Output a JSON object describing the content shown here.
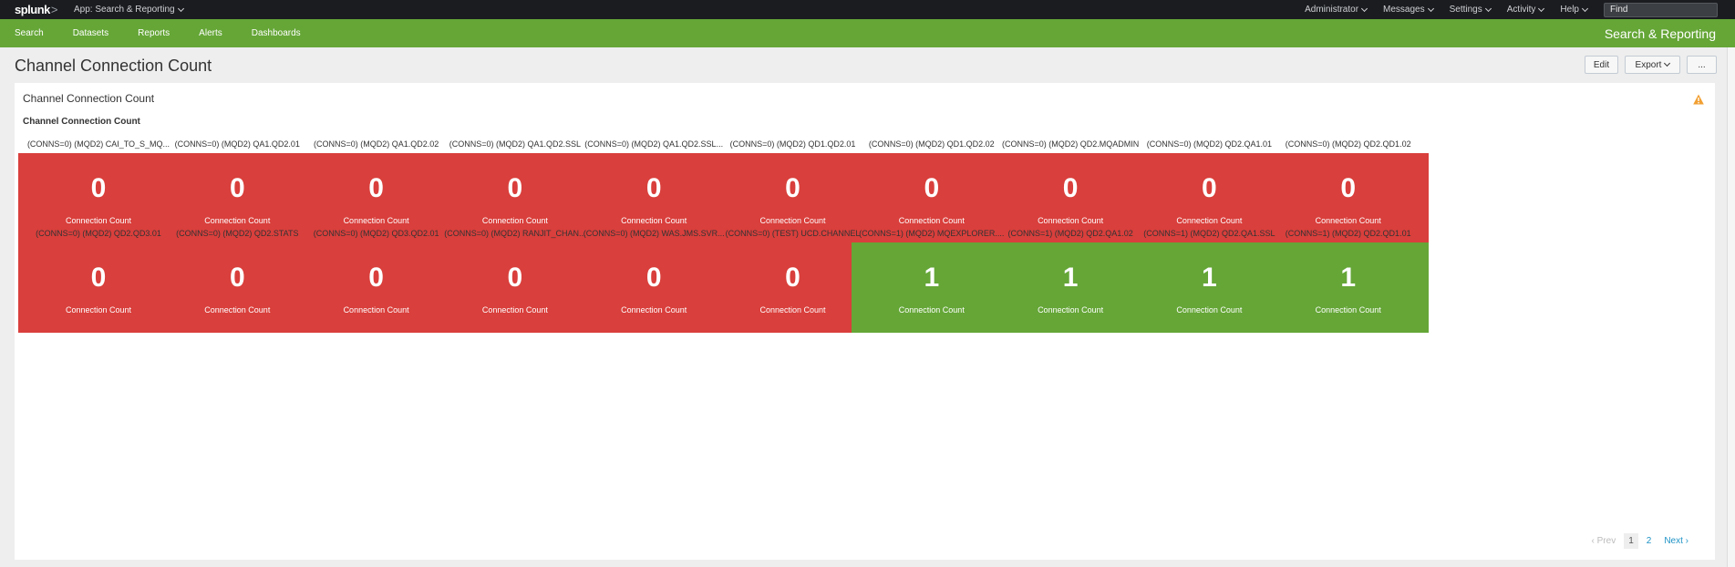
{
  "topbar": {
    "logo": "splunk",
    "logo_suffix": ">",
    "app_menu": "App: Search & Reporting",
    "menus": [
      "Administrator",
      "Messages",
      "Settings",
      "Activity",
      "Help"
    ],
    "find_placeholder": "Find"
  },
  "nav": {
    "items": [
      "Search",
      "Datasets",
      "Reports",
      "Alerts",
      "Dashboards"
    ],
    "app_title": "Search & Reporting"
  },
  "page": {
    "title": "Channel Connection Count",
    "edit_label": "Edit",
    "export_label": "Export",
    "more_label": "..."
  },
  "panel": {
    "title": "Channel Connection Count",
    "viz_title": "Channel Connection Count"
  },
  "colors": {
    "red": "#d93f3c",
    "green": "#65a637",
    "nav_green": "#65a637",
    "warning": "#f1a033"
  },
  "tiles": [
    {
      "label": "(CONNS=0) (MQD2) CAI_TO_S_MQ...",
      "value": "0",
      "sub": "Connection Count",
      "status": "red"
    },
    {
      "label": "(CONNS=0) (MQD2) QA1.QD2.01",
      "value": "0",
      "sub": "Connection Count",
      "status": "red"
    },
    {
      "label": "(CONNS=0) (MQD2) QA1.QD2.02",
      "value": "0",
      "sub": "Connection Count",
      "status": "red"
    },
    {
      "label": "(CONNS=0) (MQD2) QA1.QD2.SSL",
      "value": "0",
      "sub": "Connection Count",
      "status": "red"
    },
    {
      "label": "(CONNS=0) (MQD2) QA1.QD2.SSL...",
      "value": "0",
      "sub": "Connection Count",
      "status": "red"
    },
    {
      "label": "(CONNS=0) (MQD2) QD1.QD2.01",
      "value": "0",
      "sub": "Connection Count",
      "status": "red"
    },
    {
      "label": "(CONNS=0) (MQD2) QD1.QD2.02",
      "value": "0",
      "sub": "Connection Count",
      "status": "red"
    },
    {
      "label": "(CONNS=0) (MQD2) QD2.MQADMIN",
      "value": "0",
      "sub": "Connection Count",
      "status": "red"
    },
    {
      "label": "(CONNS=0) (MQD2) QD2.QA1.01",
      "value": "0",
      "sub": "Connection Count",
      "status": "red"
    },
    {
      "label": "(CONNS=0) (MQD2) QD2.QD1.02",
      "value": "0",
      "sub": "Connection Count",
      "status": "red"
    },
    {
      "label": "(CONNS=0) (MQD2) QD2.QD3.01",
      "value": "0",
      "sub": "Connection Count",
      "status": "red"
    },
    {
      "label": "(CONNS=0) (MQD2) QD2.STATS",
      "value": "0",
      "sub": "Connection Count",
      "status": "red"
    },
    {
      "label": "(CONNS=0) (MQD2) QD3.QD2.01",
      "value": "0",
      "sub": "Connection Count",
      "status": "red"
    },
    {
      "label": "(CONNS=0) (MQD2) RANJIT_CHAN...",
      "value": "0",
      "sub": "Connection Count",
      "status": "red"
    },
    {
      "label": "(CONNS=0) (MQD2) WAS.JMS.SVR...",
      "value": "0",
      "sub": "Connection Count",
      "status": "red"
    },
    {
      "label": "(CONNS=0) (TEST) UCD.CHANNEL",
      "value": "0",
      "sub": "Connection Count",
      "status": "red"
    },
    {
      "label": "(CONNS=1) (MQD2) MQEXPLORER....",
      "value": "1",
      "sub": "Connection Count",
      "status": "green"
    },
    {
      "label": "(CONNS=1) (MQD2) QD2.QA1.02",
      "value": "1",
      "sub": "Connection Count",
      "status": "green"
    },
    {
      "label": "(CONNS=1) (MQD2) QD2.QA1.SSL",
      "value": "1",
      "sub": "Connection Count",
      "status": "green"
    },
    {
      "label": "(CONNS=1) (MQD2) QD2.QD1.01",
      "value": "1",
      "sub": "Connection Count",
      "status": "green"
    }
  ],
  "pager": {
    "prev": "Prev",
    "pages": [
      "1",
      "2"
    ],
    "current": "1",
    "next": "Next"
  }
}
